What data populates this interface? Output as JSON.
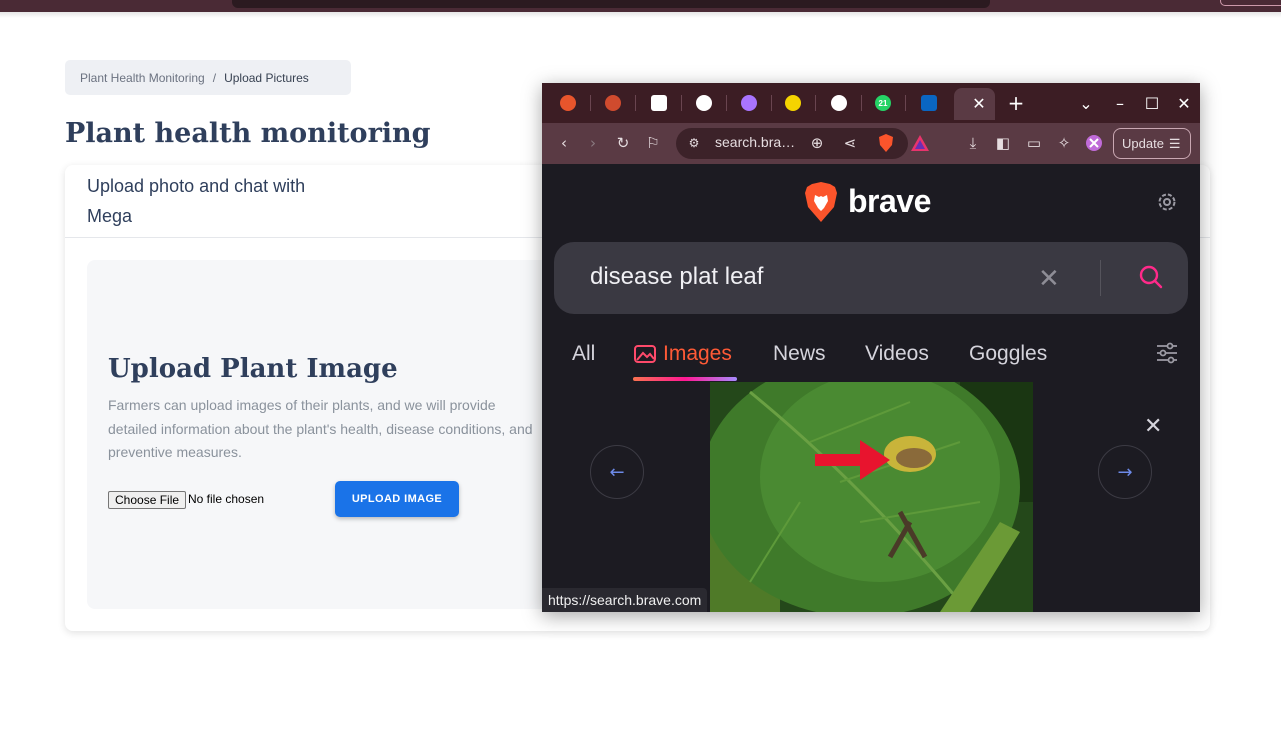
{
  "breadcrumb": {
    "parent": "Plant Health Monitoring",
    "separator": "/",
    "current": "Upload Pictures"
  },
  "page": {
    "title": "Plant health monitoring"
  },
  "card": {
    "header": "Upload photo and chat with Mega",
    "upload": {
      "title": "Upload Plant Image",
      "description": "Farmers can upload images of their plants, and we will provide detailed information about the plant's health, disease conditions, and preventive measures.",
      "file_button": "Choose File",
      "file_status": "No file chosen",
      "upload_button": "UPLOAD IMAGE"
    }
  },
  "brave": {
    "tabs": [
      {
        "icon": "brave-shield-icon",
        "color": "#e8552c"
      },
      {
        "icon": "record-icon",
        "color": "#d04b2e"
      },
      {
        "icon": "document-icon",
        "color": "#ffffff"
      },
      {
        "icon": "chatgpt-icon",
        "color": "#ffffff"
      },
      {
        "icon": "vite-icon",
        "color": "#a974ff"
      },
      {
        "icon": "r-logo-icon",
        "color": "#f5d400"
      },
      {
        "icon": "github-icon",
        "color": "#ffffff"
      },
      {
        "icon": "whatsapp-icon",
        "color": "#25d366"
      },
      {
        "icon": "linkedin-icon",
        "color": "#0a66c2"
      }
    ],
    "whatsapp_badge": "21",
    "url": "search.bra…",
    "update_label": "Update",
    "logo_text": "brave",
    "search": {
      "query": "disease plat leaf"
    },
    "search_tabs": [
      {
        "label": "All",
        "active": false
      },
      {
        "label": "Images",
        "active": true
      },
      {
        "label": "News",
        "active": false
      },
      {
        "label": "Videos",
        "active": false
      },
      {
        "label": "Goggles",
        "active": false
      }
    ],
    "status_url": "https://search.brave.com"
  }
}
